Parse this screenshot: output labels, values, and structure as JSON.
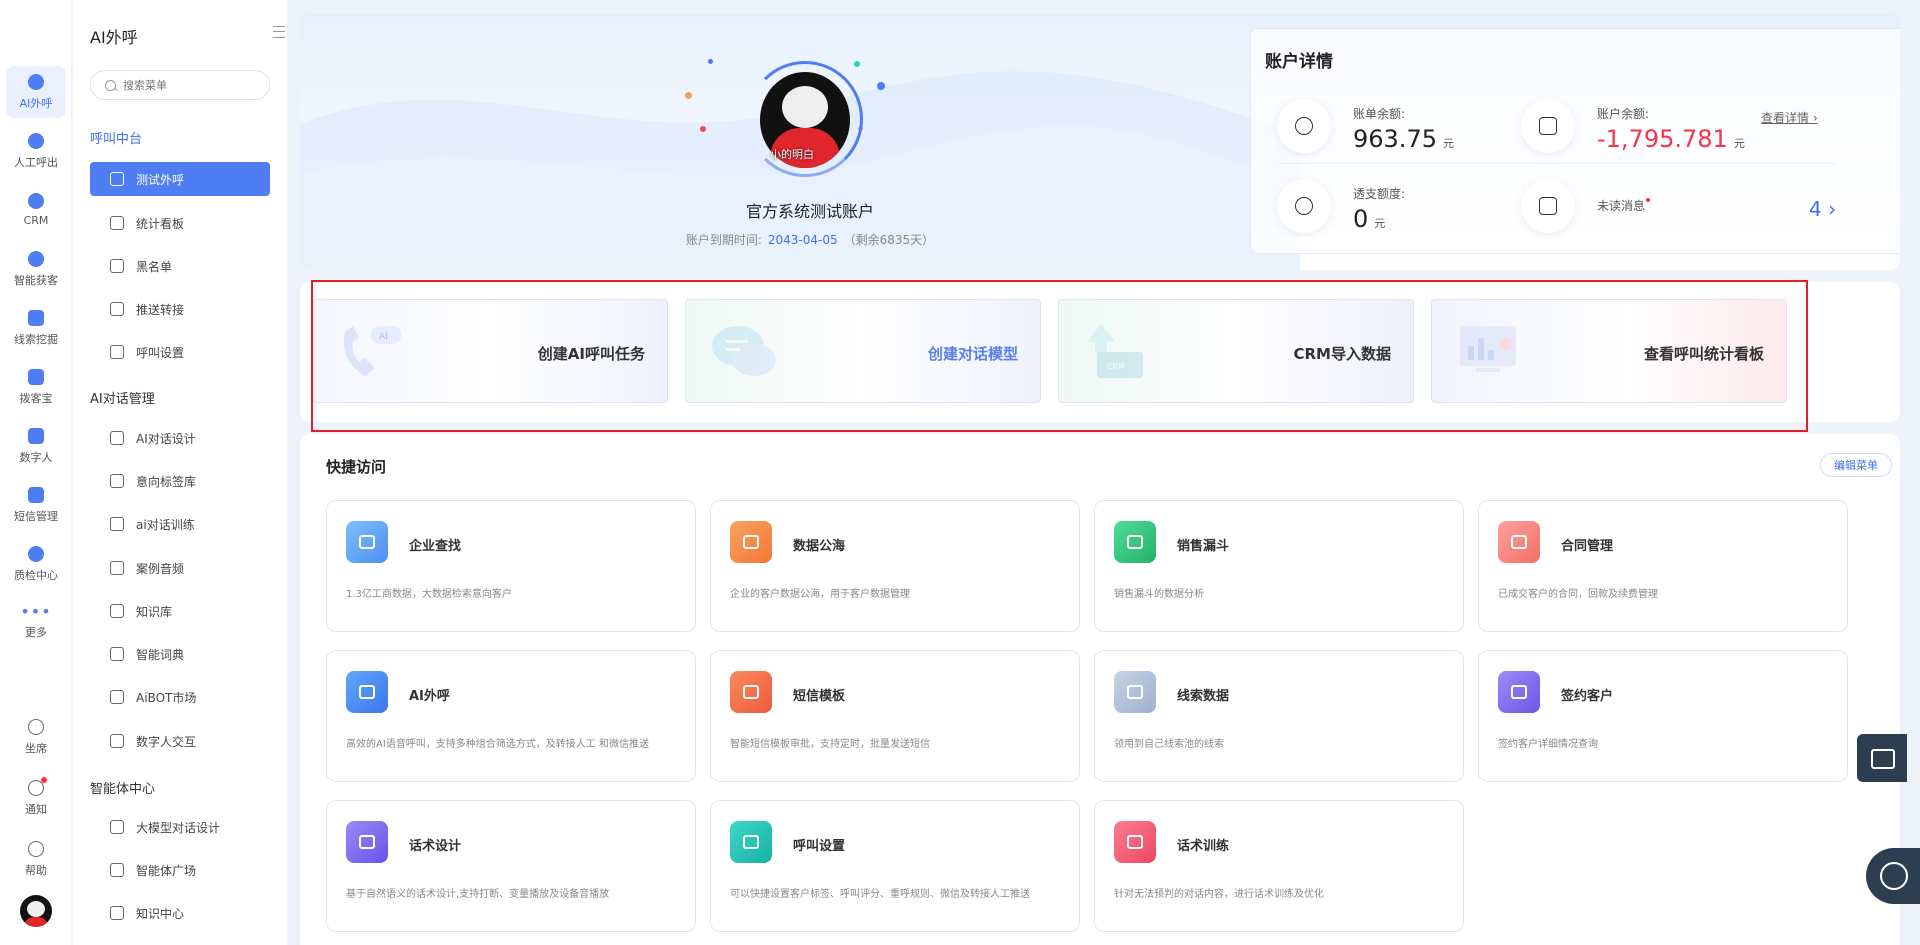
{
  "rail": {
    "items": [
      {
        "label": "AI外呼"
      },
      {
        "label": "人工呼出"
      },
      {
        "label": "CRM"
      },
      {
        "label": "智能获客"
      },
      {
        "label": "线索挖掘"
      },
      {
        "label": "拨客宝"
      },
      {
        "label": "数字人"
      },
      {
        "label": "短信管理"
      },
      {
        "label": "质检中心"
      },
      {
        "label": "更多"
      }
    ],
    "bottom": [
      {
        "label": "坐席"
      },
      {
        "label": "通知"
      },
      {
        "label": "帮助"
      }
    ]
  },
  "menu": {
    "title": "AI外呼",
    "search_placeholder": "搜索菜单",
    "groups": [
      {
        "title": "呼叫中台",
        "items": [
          "测试外呼",
          "统计看板",
          "黑名单",
          "推送转接",
          "呼叫设置"
        ]
      },
      {
        "title": "AI对话管理",
        "items": [
          "AI对话设计",
          "意向标签库",
          "ai对话训练",
          "案例音频",
          "知识库",
          "智能词典",
          "AiBOT市场",
          "数字人交互"
        ]
      },
      {
        "title": "智能体中心",
        "items": [
          "大模型对话设计",
          "智能体广场",
          "知识中心"
        ]
      }
    ]
  },
  "profile": {
    "avatar_caption": "小的明白",
    "account_name": "官方系统测试账户",
    "expire_label": "账户到期时间:",
    "expire_date": "2043-04-05",
    "expire_remain": "（剩余6835天）"
  },
  "account": {
    "title": "账户详情",
    "bill_balance_label": "账单余额:",
    "bill_balance_value": "963.75",
    "account_balance_label": "账户余额:",
    "account_balance_value": "-1,795.781",
    "overdraft_label": "透支额度:",
    "overdraft_value": "0",
    "unit": "元",
    "view_detail": "查看详情 ›",
    "unread_label": "未读消息",
    "unread_count": "4 ›"
  },
  "actions": [
    {
      "label": "创建AI呼叫任务"
    },
    {
      "label": "创建对话模型"
    },
    {
      "label": "CRM导入数据"
    },
    {
      "label": "查看呼叫统计看板"
    }
  ],
  "quick_access": {
    "title": "快捷访问",
    "edit_label": "编辑菜单",
    "cards": [
      {
        "name": "企业查找",
        "desc": "1.3亿工商数据，大数据检索意向客户",
        "color": "#5aa0f5"
      },
      {
        "name": "数据公海",
        "desc": "企业的客户数据公海，用于客户数据管理",
        "color": "#f5864a"
      },
      {
        "name": "销售漏斗",
        "desc": "销售漏斗的数据分析",
        "color": "#2fc37a"
      },
      {
        "name": "合同管理",
        "desc": "已成交客户的合同，回款及续费管理",
        "color": "#f47a72"
      },
      {
        "name": "AI外呼",
        "desc": "高效的AI语音呼叫，支持多种组合筛选方式，及转接人工 和微信推送",
        "color": "#4b8af5"
      },
      {
        "name": "短信模板",
        "desc": "智能短信模板审批，支持定时，批量发送短信",
        "color": "#f3704a"
      },
      {
        "name": "线索数据",
        "desc": "领用到自己线索池的线索",
        "color": "#a7b7d3"
      },
      {
        "name": "签约客户",
        "desc": "签约客户详细情况查询",
        "color": "#7b68ee"
      },
      {
        "name": "话术设计",
        "desc": "基于自然语义的话术设计,支持打断、变量播放及设备音播放",
        "color": "#7b6cf0"
      },
      {
        "name": "呼叫设置",
        "desc": "可以快捷设置客户标签、呼叫评分、重呼规则、微信及转接人工推送",
        "color": "#25c0b4"
      },
      {
        "name": "话术训练",
        "desc": "针对无法预判的对话内容，进行话术训练及优化",
        "color": "#f25a74"
      }
    ]
  }
}
